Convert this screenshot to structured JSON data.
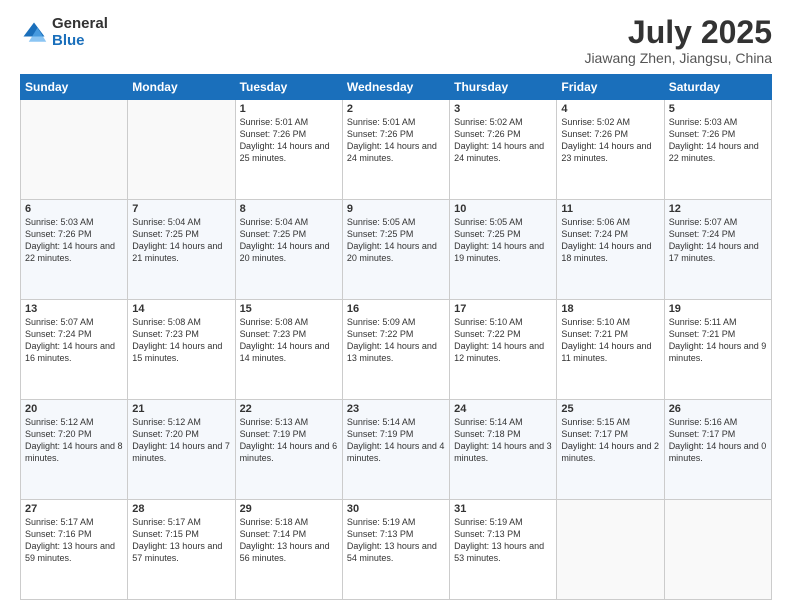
{
  "logo": {
    "general": "General",
    "blue": "Blue"
  },
  "header": {
    "month": "July 2025",
    "location": "Jiawang Zhen, Jiangsu, China"
  },
  "weekdays": [
    "Sunday",
    "Monday",
    "Tuesday",
    "Wednesday",
    "Thursday",
    "Friday",
    "Saturday"
  ],
  "weeks": [
    [
      {
        "day": "",
        "content": ""
      },
      {
        "day": "",
        "content": ""
      },
      {
        "day": "1",
        "content": "Sunrise: 5:01 AM\nSunset: 7:26 PM\nDaylight: 14 hours and 25 minutes."
      },
      {
        "day": "2",
        "content": "Sunrise: 5:01 AM\nSunset: 7:26 PM\nDaylight: 14 hours and 24 minutes."
      },
      {
        "day": "3",
        "content": "Sunrise: 5:02 AM\nSunset: 7:26 PM\nDaylight: 14 hours and 24 minutes."
      },
      {
        "day": "4",
        "content": "Sunrise: 5:02 AM\nSunset: 7:26 PM\nDaylight: 14 hours and 23 minutes."
      },
      {
        "day": "5",
        "content": "Sunrise: 5:03 AM\nSunset: 7:26 PM\nDaylight: 14 hours and 22 minutes."
      }
    ],
    [
      {
        "day": "6",
        "content": "Sunrise: 5:03 AM\nSunset: 7:26 PM\nDaylight: 14 hours and 22 minutes."
      },
      {
        "day": "7",
        "content": "Sunrise: 5:04 AM\nSunset: 7:25 PM\nDaylight: 14 hours and 21 minutes."
      },
      {
        "day": "8",
        "content": "Sunrise: 5:04 AM\nSunset: 7:25 PM\nDaylight: 14 hours and 20 minutes."
      },
      {
        "day": "9",
        "content": "Sunrise: 5:05 AM\nSunset: 7:25 PM\nDaylight: 14 hours and 20 minutes."
      },
      {
        "day": "10",
        "content": "Sunrise: 5:05 AM\nSunset: 7:25 PM\nDaylight: 14 hours and 19 minutes."
      },
      {
        "day": "11",
        "content": "Sunrise: 5:06 AM\nSunset: 7:24 PM\nDaylight: 14 hours and 18 minutes."
      },
      {
        "day": "12",
        "content": "Sunrise: 5:07 AM\nSunset: 7:24 PM\nDaylight: 14 hours and 17 minutes."
      }
    ],
    [
      {
        "day": "13",
        "content": "Sunrise: 5:07 AM\nSunset: 7:24 PM\nDaylight: 14 hours and 16 minutes."
      },
      {
        "day": "14",
        "content": "Sunrise: 5:08 AM\nSunset: 7:23 PM\nDaylight: 14 hours and 15 minutes."
      },
      {
        "day": "15",
        "content": "Sunrise: 5:08 AM\nSunset: 7:23 PM\nDaylight: 14 hours and 14 minutes."
      },
      {
        "day": "16",
        "content": "Sunrise: 5:09 AM\nSunset: 7:22 PM\nDaylight: 14 hours and 13 minutes."
      },
      {
        "day": "17",
        "content": "Sunrise: 5:10 AM\nSunset: 7:22 PM\nDaylight: 14 hours and 12 minutes."
      },
      {
        "day": "18",
        "content": "Sunrise: 5:10 AM\nSunset: 7:21 PM\nDaylight: 14 hours and 11 minutes."
      },
      {
        "day": "19",
        "content": "Sunrise: 5:11 AM\nSunset: 7:21 PM\nDaylight: 14 hours and 9 minutes."
      }
    ],
    [
      {
        "day": "20",
        "content": "Sunrise: 5:12 AM\nSunset: 7:20 PM\nDaylight: 14 hours and 8 minutes."
      },
      {
        "day": "21",
        "content": "Sunrise: 5:12 AM\nSunset: 7:20 PM\nDaylight: 14 hours and 7 minutes."
      },
      {
        "day": "22",
        "content": "Sunrise: 5:13 AM\nSunset: 7:19 PM\nDaylight: 14 hours and 6 minutes."
      },
      {
        "day": "23",
        "content": "Sunrise: 5:14 AM\nSunset: 7:19 PM\nDaylight: 14 hours and 4 minutes."
      },
      {
        "day": "24",
        "content": "Sunrise: 5:14 AM\nSunset: 7:18 PM\nDaylight: 14 hours and 3 minutes."
      },
      {
        "day": "25",
        "content": "Sunrise: 5:15 AM\nSunset: 7:17 PM\nDaylight: 14 hours and 2 minutes."
      },
      {
        "day": "26",
        "content": "Sunrise: 5:16 AM\nSunset: 7:17 PM\nDaylight: 14 hours and 0 minutes."
      }
    ],
    [
      {
        "day": "27",
        "content": "Sunrise: 5:17 AM\nSunset: 7:16 PM\nDaylight: 13 hours and 59 minutes."
      },
      {
        "day": "28",
        "content": "Sunrise: 5:17 AM\nSunset: 7:15 PM\nDaylight: 13 hours and 57 minutes."
      },
      {
        "day": "29",
        "content": "Sunrise: 5:18 AM\nSunset: 7:14 PM\nDaylight: 13 hours and 56 minutes."
      },
      {
        "day": "30",
        "content": "Sunrise: 5:19 AM\nSunset: 7:13 PM\nDaylight: 13 hours and 54 minutes."
      },
      {
        "day": "31",
        "content": "Sunrise: 5:19 AM\nSunset: 7:13 PM\nDaylight: 13 hours and 53 minutes."
      },
      {
        "day": "",
        "content": ""
      },
      {
        "day": "",
        "content": ""
      }
    ]
  ]
}
